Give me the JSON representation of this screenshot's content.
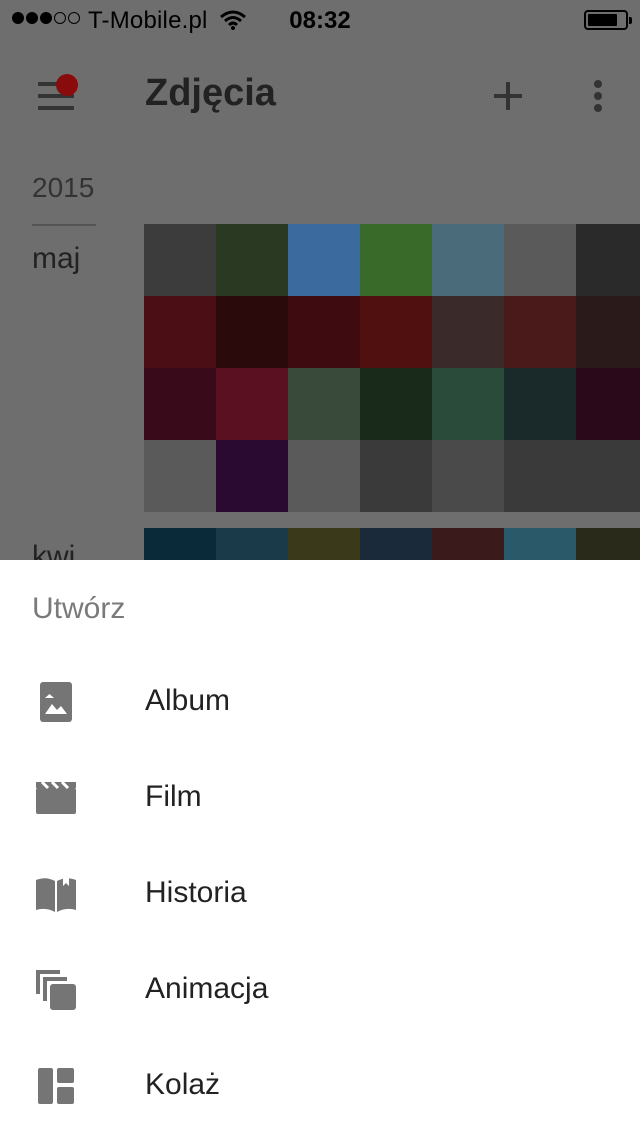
{
  "status_bar": {
    "carrier": "T-Mobile.pl",
    "time": "08:32",
    "signal_bars": 3,
    "signal_total": 5,
    "battery_level": 0.8
  },
  "app_bar": {
    "title": "Zdjęcia",
    "add_icon": "plus-icon",
    "more_icon": "more-vert-icon",
    "menu_icon": "hamburger-menu-icon"
  },
  "timeline": {
    "year": "2015",
    "month": "maj",
    "next_month_partial": "kwi"
  },
  "sheet": {
    "title": "Utwórz",
    "items": [
      {
        "label": "Album",
        "icon": "album-photo-icon"
      },
      {
        "label": "Film",
        "icon": "movie-clapper-icon"
      },
      {
        "label": "Historia",
        "icon": "story-book-icon"
      },
      {
        "label": "Animacja",
        "icon": "animation-stack-icon"
      },
      {
        "label": "Kolaż",
        "icon": "collage-icon"
      }
    ]
  },
  "colors": {
    "scrim_background": "#6e6e6e",
    "sheet_background": "#ffffff",
    "notification_dot": "#8a0b0b",
    "icon_gray": "#757575"
  },
  "photo_tile_colors": [
    "#3c3c3c",
    "#2a3a22",
    "#3a6a9e",
    "#3a6a2a",
    "#4a6b7a",
    "#5a5a5a",
    "#2a2a2a",
    "#4a0e14",
    "#2a0a0a",
    "#3e0b11",
    "#501010",
    "#3a2a2a",
    "#4a1a1a",
    "#2a1a1a",
    "#380a1a",
    "#5a1020",
    "#3a4a3a",
    "#1a2a1a",
    "#2a4a3a",
    "#1a2a2a",
    "#2a0a1a",
    "#5a5a5a",
    "#2a0a30",
    "#5a5a5a",
    "#3a3a3a",
    "#4a4a4a",
    "#3a3a3a",
    "#3a3a3a"
  ],
  "photo_tile_colors_2": [
    "#0a2a3a",
    "#1a3a4a",
    "#3a3a1a",
    "#1a2a3a",
    "#3a1a1a",
    "#2a5a6a",
    "#2a2a1a"
  ]
}
